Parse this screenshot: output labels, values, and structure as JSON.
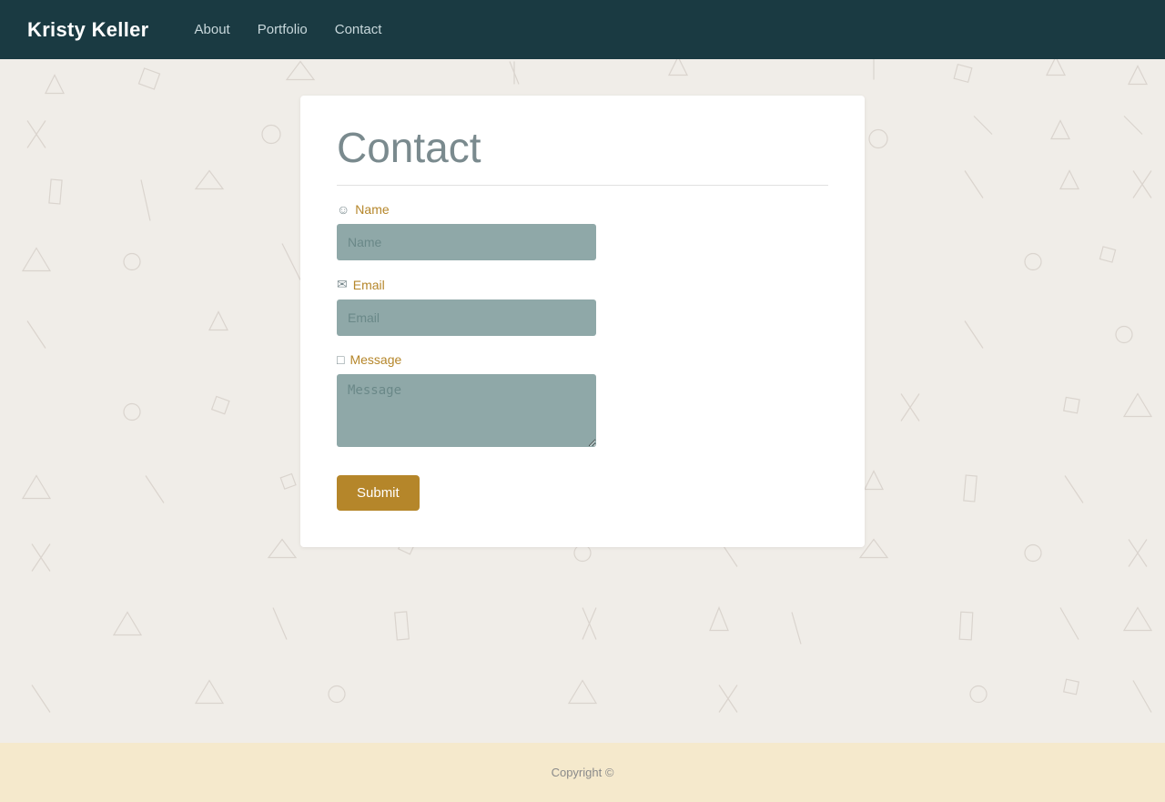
{
  "nav": {
    "brand": "Kristy Keller",
    "links": [
      {
        "label": "About",
        "id": "about"
      },
      {
        "label": "Portfolio",
        "id": "portfolio"
      },
      {
        "label": "Contact",
        "id": "contact"
      }
    ]
  },
  "contact": {
    "title": "Contact",
    "form": {
      "name_label": "Name",
      "name_placeholder": "Name",
      "email_label": "Email",
      "email_placeholder": "Email",
      "message_label": "Message",
      "message_placeholder": "Message",
      "submit_label": "Submit"
    }
  },
  "footer": {
    "copyright": "Copyright ©"
  }
}
